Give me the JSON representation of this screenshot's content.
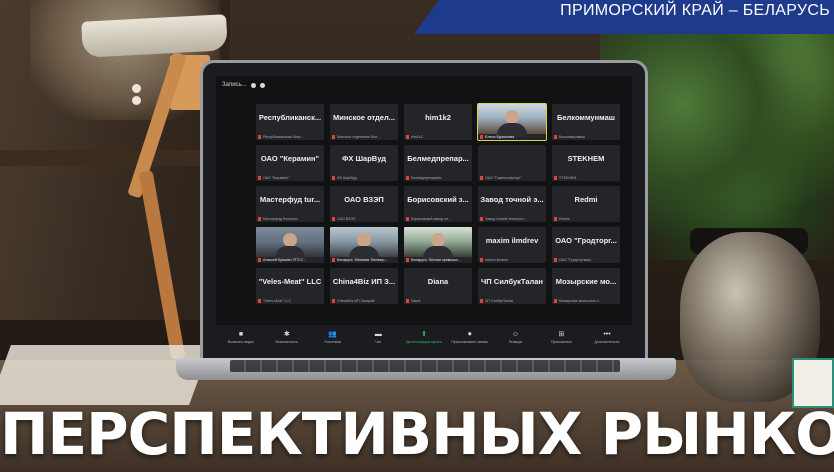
{
  "banner": {
    "ribbon_text": "ПРИМОРСКИЙ КРАЙ – БЕЛАРУСЬ",
    "headline": "ПЕРСПЕКТИВНЫХ РЫНКОВ",
    "ribbon_color": "#1e3a8c"
  },
  "conference": {
    "app_label": "Запись...",
    "tiles": [
      {
        "name": "Республиканск...",
        "sub": "Республиканская бизн...",
        "video": false
      },
      {
        "name": "Минское отдел...",
        "sub": "Минское отделение Бел...",
        "video": false
      },
      {
        "name": "him1k2",
        "sub": "him1k2",
        "video": false
      },
      {
        "name": "",
        "sub": "Елена Бурьянова",
        "video": true,
        "style": "video-a",
        "active": true
      },
      {
        "name": "Белкоммунмаш",
        "sub": "Белкоммунмаш",
        "video": false
      },
      {
        "name": "ОАО \"Керамин\"",
        "sub": "ОАО \"Керамин\"",
        "video": false
      },
      {
        "name": "ФХ ШарВуд",
        "sub": "ФХ ШарВуд",
        "video": false
      },
      {
        "name": "Белмедпрепар...",
        "sub": "Белмедпрепараты",
        "video": false
      },
      {
        "name": "",
        "sub": "ОАО \"Гомельхимторг\"",
        "video": false
      },
      {
        "name": "STEKHEM",
        "sub": "STEKHEM",
        "video": false
      },
      {
        "name": "Мастерфуд  tur...",
        "sub": "Мастерфуд Белсоюз",
        "video": false
      },
      {
        "name": "ОАО ВЗЭП",
        "sub": "ОАО ВЗЭП",
        "video": false
      },
      {
        "name": "Борисовский з...",
        "sub": "Борисовский завод пл...",
        "video": false
      },
      {
        "name": "Завод точной э...",
        "sub": "Завод точной электрон...",
        "video": false
      },
      {
        "name": "Redmi",
        "sub": "Redmi",
        "video": false
      },
      {
        "name": "",
        "sub": "Алексей Кузьмич ЗТЭ С...",
        "video": true,
        "style": "video-b"
      },
      {
        "name": "",
        "sub": "Беларусь. Минская. Белзагр...",
        "video": true,
        "style": "video-c"
      },
      {
        "name": "",
        "sub": "Беларусь. Лесная промышл...",
        "video": true,
        "style": "video-d"
      },
      {
        "name": "maxim ilmdrev",
        "sub": "maxim ilmdrev",
        "video": false
      },
      {
        "name": "ОАО \"Гродторг...",
        "sub": "ОАО \"Гродторгмаш\"",
        "video": false
      },
      {
        "name": "\"Veles-Meat\" LLC",
        "sub": "\"Veles-Meat\" LLC",
        "video": false
      },
      {
        "name": "China4Biz ИП З...",
        "sub": "China4Biz ИП Захарий",
        "video": false
      },
      {
        "name": "Diana",
        "sub": "Diana",
        "video": false
      },
      {
        "name": "ЧП СилбукТалан",
        "sub": "ЧП СилбукТалан",
        "video": false
      },
      {
        "name": "Мозырские мо...",
        "sub": "Мозырские молочные п...",
        "video": false
      }
    ],
    "toolbar": [
      {
        "glyph": "■",
        "label": "Включить видео",
        "icon": "camera-off-icon"
      },
      {
        "glyph": "✱",
        "label": "Безопасность",
        "icon": "shield-icon"
      },
      {
        "glyph": "👥",
        "label": "Участники",
        "icon": "participants-icon"
      },
      {
        "glyph": "▬",
        "label": "Чат",
        "icon": "chat-icon"
      },
      {
        "glyph": "⬆",
        "label": "Демонстрация экрана",
        "icon": "share-screen-icon"
      },
      {
        "glyph": "⏺",
        "label": "Приостановить запись",
        "icon": "record-icon"
      },
      {
        "glyph": "☺",
        "label": "Реакции",
        "icon": "reactions-icon"
      },
      {
        "glyph": "⊞",
        "label": "Приложения",
        "icon": "apps-icon"
      },
      {
        "glyph": "•••",
        "label": "Дополнительно",
        "icon": "more-icon"
      }
    ]
  }
}
